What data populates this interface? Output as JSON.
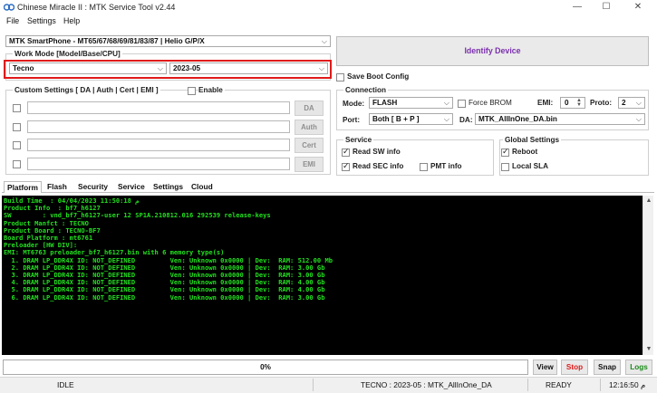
{
  "window": {
    "title": "Chinese Miracle II : MTK Service Tool v2.44"
  },
  "menu": [
    "File",
    "Settings",
    "Help"
  ],
  "chipset": {
    "selected": "MTK SmartPhone - MT65/67/68/69/81/83/87 | Helio G/P/X"
  },
  "work_mode": {
    "label": "Work Mode [Model/Base/CPU]",
    "brand": "Tecno",
    "base": "2023-05"
  },
  "identify_button": "Identify Device",
  "save_boot_config": {
    "label": "Save Boot Config",
    "checked": false
  },
  "custom_settings": {
    "label": "Custom Settings [ DA | Auth | Cert | EMI ]",
    "enable_label": "Enable",
    "buttons": [
      "DA",
      "Auth",
      "Cert",
      "EMI"
    ]
  },
  "connection": {
    "label": "Connection",
    "mode_label": "Mode:",
    "mode_value": "FLASH",
    "force_brom_label": "Force BROM",
    "emi_label": "EMI:",
    "emi_value": "0",
    "proto_label": "Proto:",
    "proto_value": "2",
    "port_label": "Port:",
    "port_value": "Both [ B + P ]",
    "da_label": "DA:",
    "da_value": "MTK_AllInOne_DA.bin"
  },
  "service": {
    "label": "Service",
    "read_sw_info": "Read SW info",
    "read_sec_info": "Read SEC info",
    "pmt_info": "PMT info"
  },
  "global_settings": {
    "label": "Global Settings",
    "reboot": "Reboot",
    "local_sla": "Local SLA"
  },
  "tabs": [
    "Platform",
    "Flash",
    "Security",
    "Service",
    "Settings",
    "Cloud"
  ],
  "console": {
    "lines": [
      "Build Time  : 04/04/2023 11:50:18 م",
      "Product Info  : bf7_h6127",
      "SW        : vnd_bf7_h6127-user 12 SP1A.210812.016 292539 release-keys",
      "Product Manfct : TECNO",
      "Product Board : TECNO-BF7",
      "Board Platform : mt6761",
      "",
      "",
      "Preloader [HW DIV]:",
      "EMI: MT6763 preloader_bf7_h6127.bin with 6 memory type(s)",
      "  1. DRAM LP_DDR4X ID: NOT_DEFINED         Ven: Unknown 0x0000 | Dev:  RAM: 512.00 Mb",
      "  2. DRAM LP_DDR4X ID: NOT_DEFINED         Ven: Unknown 0x0000 | Dev:  RAM: 3.00 Gb",
      "  3. DRAM LP_DDR4X ID: NOT_DEFINED         Ven: Unknown 0x0000 | Dev:  RAM: 3.00 Gb",
      "  4. DRAM LP_DDR4X ID: NOT_DEFINED         Ven: Unknown 0x0000 | Dev:  RAM: 4.00 Gb",
      "  5. DRAM LP_DDR4X ID: NOT_DEFINED         Ven: Unknown 0x0000 | Dev:  RAM: 4.00 Gb",
      "  6. DRAM LP_DDR4X ID: NOT_DEFINED         Ven: Unknown 0x0000 | Dev:  RAM: 3.00 Gb"
    ]
  },
  "progress": {
    "text": "0%",
    "value": 0
  },
  "actions": {
    "view": "View",
    "stop": "Stop",
    "snap": "Snap",
    "logs": "Logs"
  },
  "statusbar": {
    "state": "IDLE",
    "info": "TECNO : 2023-05 : MTK_AllInOne_DA",
    "ready": "READY",
    "time": "12:16:50 م"
  },
  "colors": {
    "stop": "#e01a1a",
    "logs": "#1a8a1a",
    "identify": "#7b2fae",
    "highlight": "#e01a1a",
    "console_text": "#22e01f"
  }
}
